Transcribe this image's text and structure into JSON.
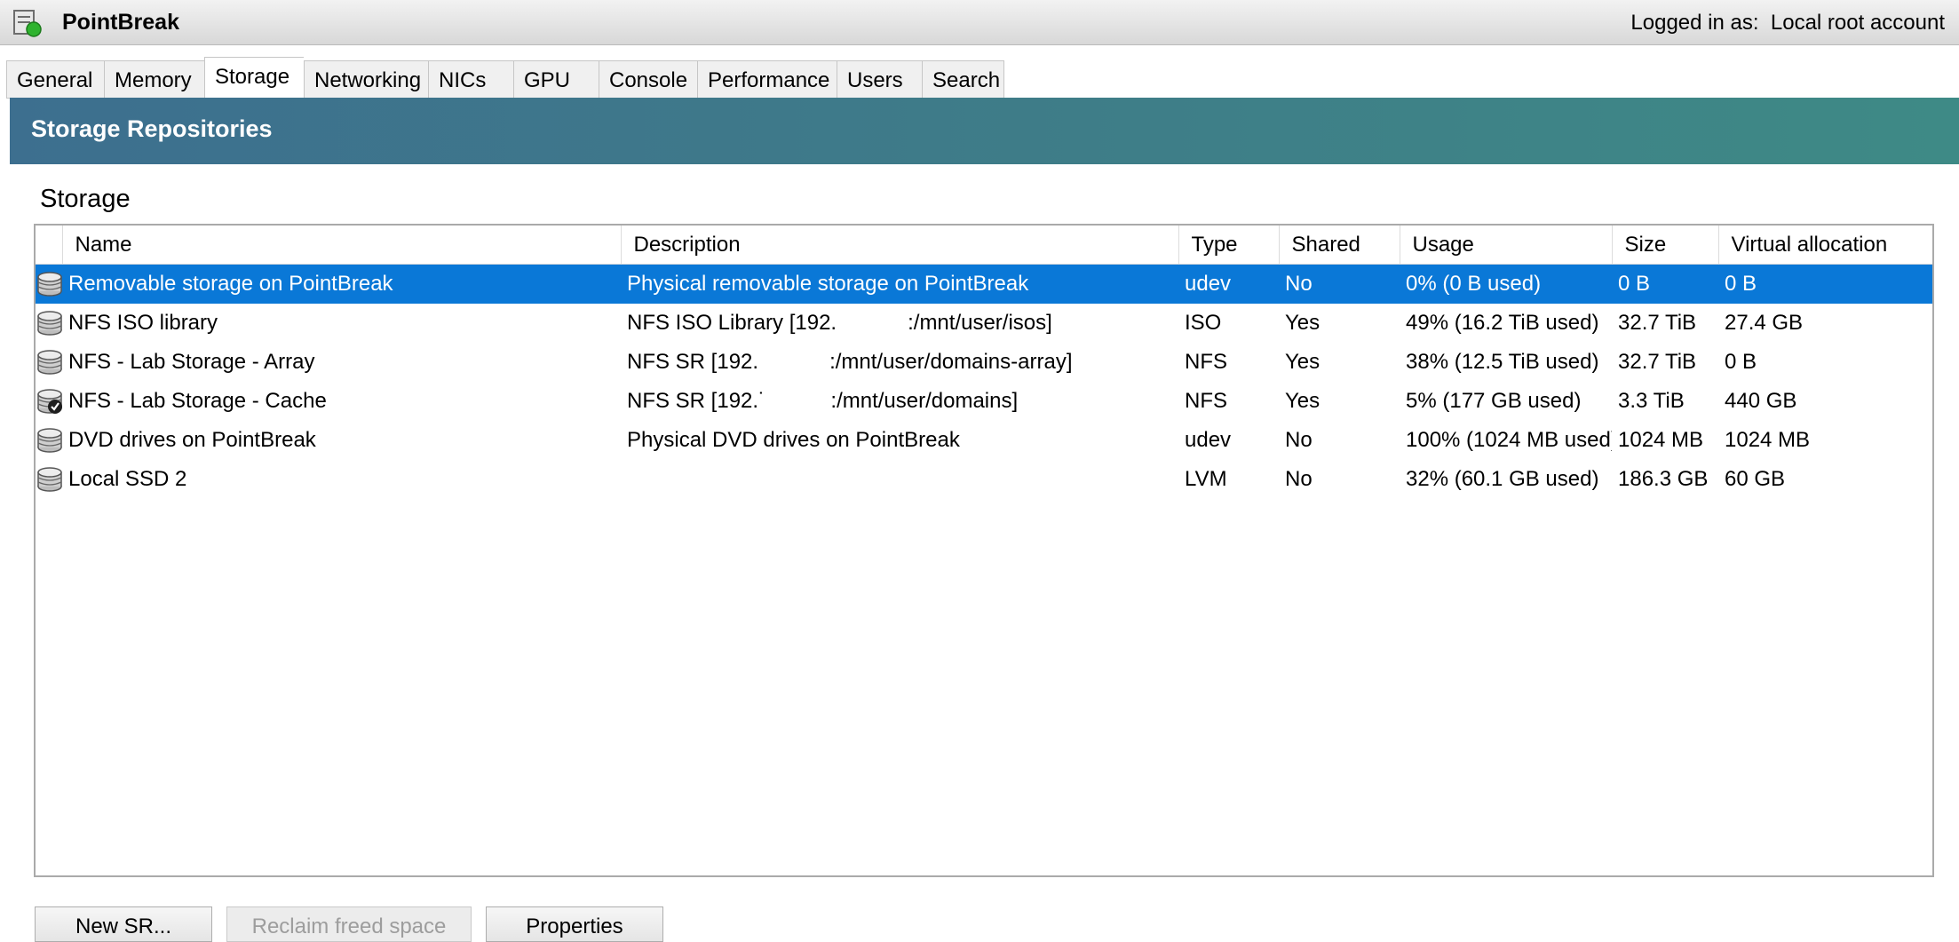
{
  "window": {
    "host_name": "PointBreak",
    "logged_in_label": "Logged in as:",
    "logged_in_user": "Local root account",
    "host_icon": "server-running-icon"
  },
  "tabs": [
    {
      "label": "General",
      "active": false
    },
    {
      "label": "Memory",
      "active": false
    },
    {
      "label": "Storage",
      "active": true
    },
    {
      "label": "Networking",
      "active": false
    },
    {
      "label": "NICs",
      "active": false
    },
    {
      "label": "GPU",
      "active": false
    },
    {
      "label": "Console",
      "active": false
    },
    {
      "label": "Performance",
      "active": false
    },
    {
      "label": "Users",
      "active": false
    },
    {
      "label": "Search",
      "active": false
    }
  ],
  "banner": {
    "title": "Storage Repositories"
  },
  "section": {
    "label": "Storage"
  },
  "table": {
    "columns": [
      "Name",
      "Description",
      "Type",
      "Shared",
      "Usage",
      "Size",
      "Virtual allocation"
    ],
    "rows": [
      {
        "icon": "storage-icon",
        "name": "Removable storage on PointBreak",
        "description": "Physical removable storage on PointBreak",
        "type": "udev",
        "shared": "No",
        "usage": "0% (0 B used)",
        "size": "0 B",
        "virtual_allocation": "0 B",
        "selected": true
      },
      {
        "icon": "storage-icon",
        "name": "NFS ISO library",
        "description": "NFS ISO Library [192.            :/mnt/user/isos]",
        "type": "ISO",
        "shared": "Yes",
        "usage": "49% (16.2 TiB used)",
        "size": "32.7 TiB",
        "virtual_allocation": "27.4 GB",
        "selected": false
      },
      {
        "icon": "storage-icon",
        "name": "NFS - Lab Storage - Array",
        "description": "NFS SR [192.            :/mnt/user/domains-array]",
        "type": "NFS",
        "shared": "Yes",
        "usage": "38% (12.5 TiB used)",
        "size": "32.7 TiB",
        "virtual_allocation": "0 B",
        "selected": false
      },
      {
        "icon": "storage-default-icon",
        "name": "NFS - Lab Storage - Cache",
        "description": "NFS SR [192.˙           :/mnt/user/domains]",
        "type": "NFS",
        "shared": "Yes",
        "usage": "5% (177 GB used)",
        "size": "3.3 TiB",
        "virtual_allocation": "440 GB",
        "selected": false
      },
      {
        "icon": "storage-icon",
        "name": "DVD drives on PointBreak",
        "description": "Physical DVD drives on PointBreak",
        "type": "udev",
        "shared": "No",
        "usage": "100% (1024 MB used)",
        "size": "1024 MB",
        "virtual_allocation": "1024 MB",
        "selected": false
      },
      {
        "icon": "storage-icon",
        "name": "Local SSD 2",
        "description": "",
        "type": "LVM",
        "shared": "No",
        "usage": "32% (60.1 GB used)",
        "size": "186.3 GB",
        "virtual_allocation": "60 GB",
        "selected": false
      }
    ]
  },
  "buttons": {
    "new_sr": "New SR...",
    "reclaim": "Reclaim freed space",
    "properties": "Properties"
  },
  "colors": {
    "selection": "#0a78d7",
    "banner_start": "#3d6f8f",
    "banner_end": "#3e8a86"
  }
}
